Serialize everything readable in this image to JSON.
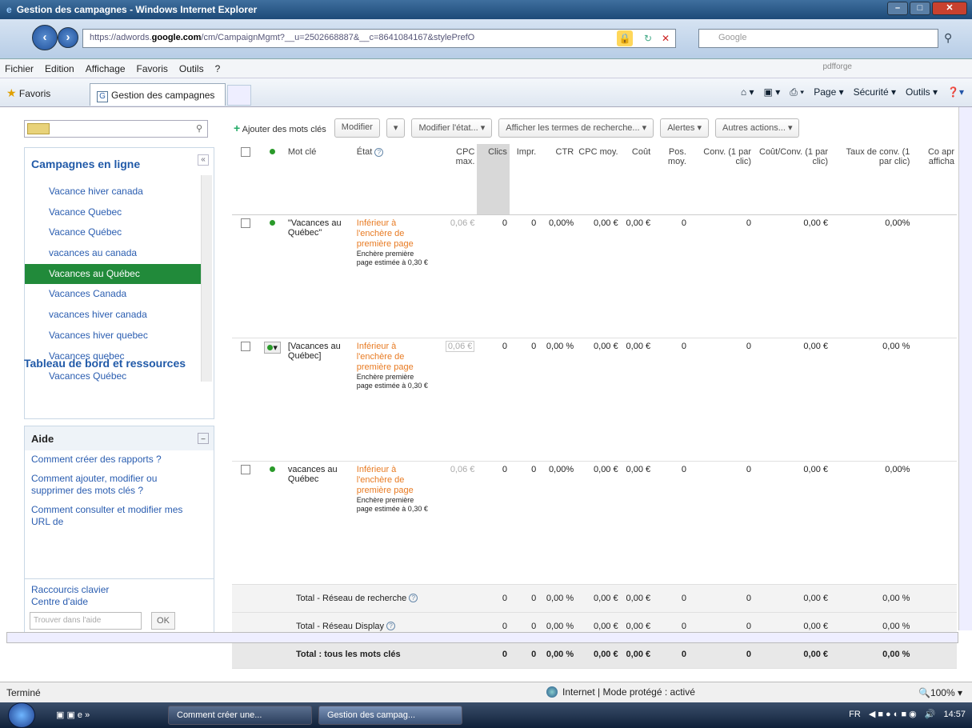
{
  "window": {
    "title": "Gestion des campagnes - Windows Internet Explorer"
  },
  "address": {
    "url_prefix": "https://adwords.",
    "url_domain": "google.com",
    "url_rest": "/cm/CampaignMgmt?__u=2502668887&__c=8641084167&stylePrefO",
    "search_placeholder": "Google"
  },
  "menu": [
    "Fichier",
    "Edition",
    "Affichage",
    "Favoris",
    "Outils",
    "?"
  ],
  "pdfforge": "pdfforge",
  "favorites": {
    "label": "Favoris",
    "tab": "Gestion des campagnes"
  },
  "commands": [
    "Page ▾",
    "Sécurité ▾",
    "Outils ▾"
  ],
  "left_panel": {
    "campaigns_heading": "Campagnes en ligne",
    "campaigns": [
      {
        "label": "Vacance hiver canada",
        "selected": false
      },
      {
        "label": "Vacance Quebec",
        "selected": false
      },
      {
        "label": "Vacance Québec",
        "selected": false
      },
      {
        "label": "vacances au canada",
        "selected": false
      },
      {
        "label": "Vacances au Québec",
        "selected": true
      },
      {
        "label": "Vacances Canada",
        "selected": false
      },
      {
        "label": "vacances hiver canada",
        "selected": false
      },
      {
        "label": "Vacances hiver quebec",
        "selected": false
      },
      {
        "label": "Vacances quebec",
        "selected": false
      },
      {
        "label": "Vacances Québec",
        "selected": false
      }
    ],
    "dashboard": "Tableau de bord et ressources",
    "help": {
      "heading": "Aide",
      "links": [
        "Comment créer des rapports ?",
        "Comment ajouter, modifier ou supprimer des mots clés ?",
        "Comment consulter et modifier mes URL de"
      ],
      "footer": [
        "Raccourcis clavier",
        "Centre d'aide"
      ],
      "search_placeholder": "Trouver dans l'aide",
      "ok": "OK"
    }
  },
  "toolbar": {
    "add_keywords": "Ajouter des mots clés",
    "modify": "Modifier",
    "modify_state": "Modifier l'état... ▾",
    "show_terms": "Afficher les termes de recherche... ▾",
    "alerts": "Alertes ▾",
    "other": "Autres actions... ▾"
  },
  "columns": {
    "keyword": "Mot clé",
    "state": "État",
    "cpc_max": "CPC max.",
    "clics": "Clics",
    "impr": "Impr.",
    "ctr": "CTR",
    "cpc_avg": "CPC moy.",
    "cost": "Coût",
    "pos": "Pos. moy.",
    "conv": "Conv. (1 par clic)",
    "cost_conv": "Coût/Conv. (1 par clic)",
    "rate": "Taux de conv. (1 par clic)",
    "extra": "Co apr afficha"
  },
  "rows": [
    {
      "keyword": "\"Vacances au Québec\"",
      "state_link": "Inférieur à l'enchère de première page",
      "state_note": "Enchère première page estimée à 0,30 €",
      "cpc_max": "0,06 €",
      "clics": "0",
      "impr": "0",
      "ctr": "0,00%",
      "cpc_avg": "0,00 €",
      "cost": "0,00 €",
      "pos": "0",
      "conv": "0",
      "cost_conv": "0,00 €",
      "rate": "0,00%"
    },
    {
      "keyword": "[Vacances au Québec]",
      "state_link": "Inférieur à l'enchère de première page",
      "state_note": "Enchère première page estimée à 0,30 €",
      "cpc_max": "0,06 €",
      "clics": "0",
      "impr": "0",
      "ctr": "0,00 %",
      "cpc_avg": "0,00 €",
      "cost": "0,00 €",
      "pos": "0",
      "conv": "0",
      "cost_conv": "0,00 €",
      "rate": "0,00 %"
    },
    {
      "keyword": "vacances au Québec",
      "state_link": "Inférieur à l'enchère de première page",
      "state_note": "Enchère première page estimée à 0,30 €",
      "cpc_max": "0,06 €",
      "clics": "0",
      "impr": "0",
      "ctr": "0,00%",
      "cpc_avg": "0,00 €",
      "cost": "0,00 €",
      "pos": "0",
      "conv": "0",
      "cost_conv": "0,00 €",
      "rate": "0,00%"
    }
  ],
  "totals": [
    {
      "label": "Total - Réseau de recherche",
      "clics": "0",
      "impr": "0",
      "ctr": "0,00 %",
      "cpc_avg": "0,00 €",
      "cost": "0,00 €",
      "pos": "0",
      "conv": "0",
      "cost_conv": "0,00 €",
      "rate": "0,00 %"
    },
    {
      "label": "Total - Réseau Display",
      "clics": "0",
      "impr": "0",
      "ctr": "0,00 %",
      "cpc_avg": "0,00 €",
      "cost": "0,00 €",
      "pos": "0",
      "conv": "0",
      "cost_conv": "0,00 €",
      "rate": "0,00 %"
    },
    {
      "label": "Total : tous les mots clés",
      "clics": "0",
      "impr": "0",
      "ctr": "0,00 %",
      "cpc_avg": "0,00 €",
      "cost": "0,00 €",
      "pos": "0",
      "conv": "0",
      "cost_conv": "0,00 €",
      "rate": "0,00 %"
    }
  ],
  "status": {
    "text": "Terminé",
    "zone": "Internet | Mode protégé : activé",
    "zoom": "100%"
  },
  "taskbar": {
    "task1": "Comment créer une...",
    "task2": "Gestion des campag...",
    "lang": "FR",
    "time": "14:57"
  }
}
